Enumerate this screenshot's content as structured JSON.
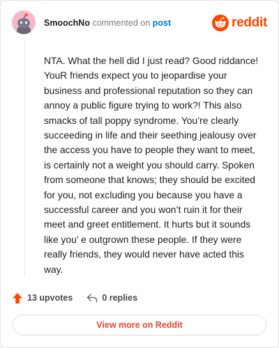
{
  "header": {
    "username": "SmoochNo",
    "action_text": "commented on",
    "post_link": "post",
    "brand": "reddit",
    "avatar_icon": "snoo-avatar-icon",
    "brand_icon": "reddit-logo-icon"
  },
  "comment": {
    "body": "NTA. What the hell did I just read? Good riddance! YouR friends expect you to jeopardise your business and professional reputation so they can annoy a public figure trying to work?! This also smacks of tall poppy syndrome. You’re clearly succeeding in life and their seething jealousy over the access you have to people they want to meet, is certainly not a weight you should carry. Spoken from someone that knows; they should be excited for you, not excluding you because you have a successful career and you won’t ruin it for their meet and greet entitlement. It hurts but it sounds like you’ e outgrown these people. If they were really friends, they would never have acted this way."
  },
  "actions": {
    "upvotes": "13 upvotes",
    "replies": "0 replies",
    "upvote_icon": "upvote-arrow-icon",
    "reply_icon": "reply-arrow-icon"
  },
  "footer": {
    "view_more": "View more on Reddit"
  },
  "colors": {
    "brand_orange": "#ff4500",
    "avatar_pink": "#f5b9ca",
    "link_blue": "#0079d3",
    "view_more_text": "#e8442e"
  }
}
